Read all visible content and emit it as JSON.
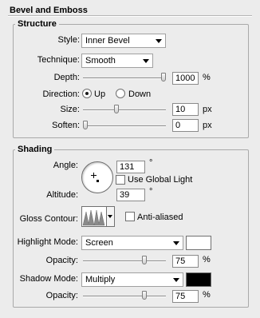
{
  "panel": {
    "title": "Bevel and Emboss"
  },
  "structure": {
    "title": "Structure",
    "style": {
      "label": "Style:",
      "value": "Inner Bevel"
    },
    "technique": {
      "label": "Technique:",
      "value": "Smooth"
    },
    "depth": {
      "label": "Depth:",
      "value": "1000",
      "unit": "%",
      "level": 1.0
    },
    "direction": {
      "label": "Direction:",
      "up": "Up",
      "down": "Down",
      "selected": "Up"
    },
    "size": {
      "label": "Size:",
      "value": "10",
      "unit": "px",
      "level": 0.4
    },
    "soften": {
      "label": "Soften:",
      "value": "0",
      "unit": "px",
      "level": 0.0
    }
  },
  "shading": {
    "title": "Shading",
    "angle": {
      "label": "Angle:",
      "value": "131",
      "unit": "°"
    },
    "global_light": {
      "label": "Use Global Light",
      "checked": false
    },
    "altitude": {
      "label": "Altitude:",
      "value": "39",
      "unit": "°"
    },
    "gloss_contour": {
      "label": "Gloss Contour:"
    },
    "anti_aliased": {
      "label": "Anti-aliased",
      "checked": false
    },
    "highlight_mode": {
      "label": "Highlight Mode:",
      "value": "Screen",
      "color": "#ffffff"
    },
    "highlight_opacity": {
      "label": "Opacity:",
      "value": "75",
      "unit": "%",
      "level": 0.75
    },
    "shadow_mode": {
      "label": "Shadow Mode:",
      "value": "Multiply",
      "color": "#000000"
    },
    "shadow_opacity": {
      "label": "Opacity:",
      "value": "75",
      "unit": "%",
      "level": 0.75
    }
  }
}
